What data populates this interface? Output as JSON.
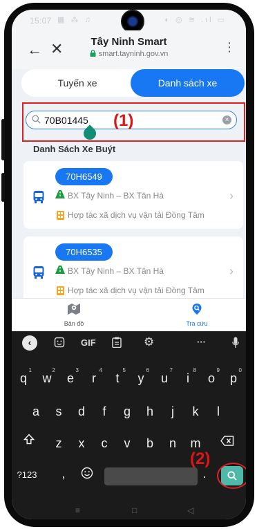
{
  "status_bar": {
    "time": "15:07",
    "left_icons": "▦ ⁂ ♫",
    "right_icons": "◐ ◎ ≋ .ıl ▭"
  },
  "browser": {
    "title": "Tây Ninh Smart",
    "url": "smart.tayninh.gov.vn"
  },
  "tabs": [
    {
      "label": "Tuyến xe",
      "active": false
    },
    {
      "label": "Danh sách xe",
      "active": true
    }
  ],
  "search": {
    "value": "70B01445",
    "annotation": "(1)"
  },
  "section_title": "Danh Sách Xe Buýt",
  "vehicles": [
    {
      "plate": "70H6549",
      "route": "BX Tây Ninh – BX Tân Hà",
      "operator": "Hợp tác xã dịch vụ vận tải Đồng Tâm"
    },
    {
      "plate": "70H6535",
      "route": "BX Tây Ninh – BX Tân Hà",
      "operator": "Hợp tác xã dịch vụ vận tải Đồng Tâm"
    }
  ],
  "bottom_nav": [
    {
      "label": "Bản đồ",
      "icon": "map-icon",
      "active": false
    },
    {
      "label": "Tra cứu",
      "icon": "lookup-icon",
      "active": true
    }
  ],
  "keyboard": {
    "toolbar": {
      "gif": "GIF",
      "more": "···"
    },
    "row1": [
      {
        "key": "q",
        "hint": "1"
      },
      {
        "key": "w",
        "hint": "2"
      },
      {
        "key": "e",
        "hint": "3"
      },
      {
        "key": "r",
        "hint": "4"
      },
      {
        "key": "t",
        "hint": "5"
      },
      {
        "key": "y",
        "hint": "6"
      },
      {
        "key": "u",
        "hint": "7"
      },
      {
        "key": "i",
        "hint": "8"
      },
      {
        "key": "o",
        "hint": "9"
      },
      {
        "key": "p",
        "hint": "0"
      }
    ],
    "row2": [
      "a",
      "s",
      "d",
      "f",
      "g",
      "h",
      "j",
      "k",
      "l"
    ],
    "row3": [
      "z",
      "x",
      "c",
      "v",
      "b",
      "n",
      "m"
    ],
    "symbols_key": "?123",
    "comma_key": ",",
    "period_key": ".",
    "annotation": "(2)"
  },
  "colors": {
    "accent": "#1877f2",
    "annotation": "#e02020",
    "search_key": "#4fb9a9"
  }
}
